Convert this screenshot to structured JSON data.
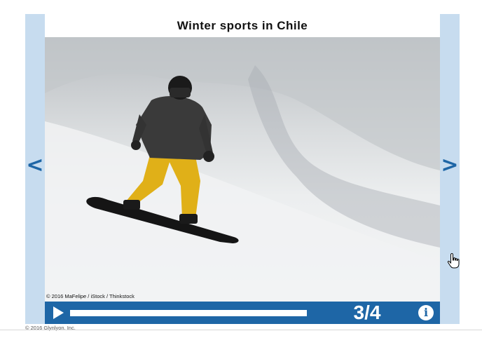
{
  "slide": {
    "title": "Winter sports in Chile",
    "photo_credit": "© 2016 MaFelipe / iStock / Thinkstock",
    "image_icon": "snowboarder-photo"
  },
  "navigation": {
    "prev_label": "<",
    "next_label": ">"
  },
  "player": {
    "play_icon": "play-icon",
    "progress": 1.0,
    "counter": "3/4",
    "info_label": "i"
  },
  "footer": {
    "copyright": "© 2016 Glynlyon, Inc."
  },
  "colors": {
    "accent": "#1e66a6",
    "side_panel": "#c7dcef",
    "jacket": "#3a3a3a",
    "pants": "#e0b018",
    "snow": "#f2f3f4"
  }
}
